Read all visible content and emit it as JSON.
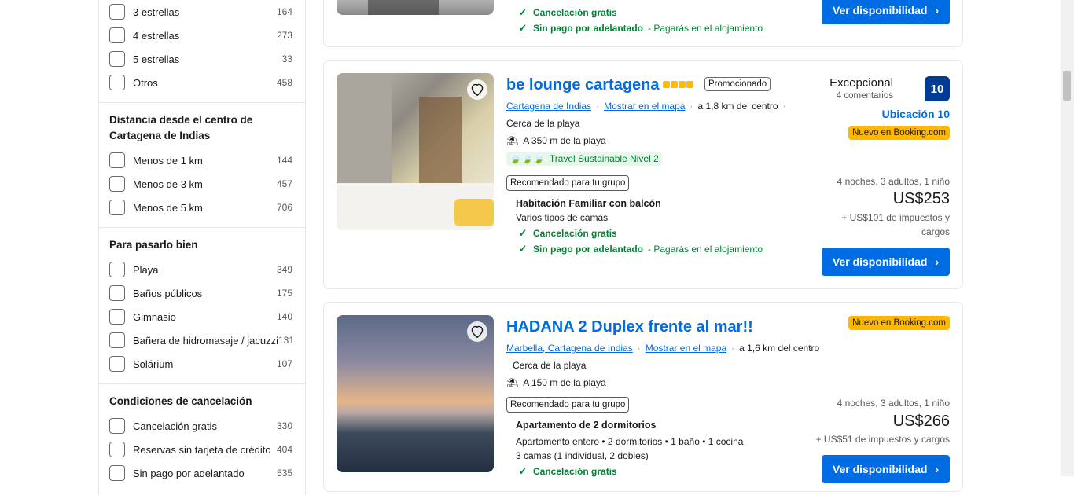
{
  "sidebar": {
    "stars": [
      {
        "label": "3 estrellas",
        "count": "164"
      },
      {
        "label": "4 estrellas",
        "count": "273"
      },
      {
        "label": "5 estrellas",
        "count": "33"
      },
      {
        "label": "Otros",
        "count": "458"
      }
    ],
    "distance": {
      "title": "Distancia desde el centro de Cartagena de Indias",
      "items": [
        {
          "label": "Menos de 1 km",
          "count": "144"
        },
        {
          "label": "Menos de 3 km",
          "count": "457"
        },
        {
          "label": "Menos de 5 km",
          "count": "706"
        }
      ]
    },
    "fun": {
      "title": "Para pasarlo bien",
      "items": [
        {
          "label": "Playa",
          "count": "349"
        },
        {
          "label": "Baños públicos",
          "count": "175"
        },
        {
          "label": "Gimnasio",
          "count": "140"
        },
        {
          "label": "Bañera de hidromasaje / jacuzzi",
          "count": "131"
        },
        {
          "label": "Solárium",
          "count": "107"
        }
      ]
    },
    "cancel": {
      "title": "Condiciones de cancelación",
      "items": [
        {
          "label": "Cancelación gratis",
          "count": "330"
        },
        {
          "label": "Reservas sin tarjeta de crédito",
          "count": "404"
        },
        {
          "label": "Sin pago por adelantado",
          "count": "535"
        }
      ]
    }
  },
  "top_card": {
    "free_cancel": "Cancelación gratis",
    "no_prepay": "Sin pago por adelantado",
    "no_prepay_note": "- Pagarás en el alojamiento",
    "button": "Ver disponibilidad"
  },
  "card1": {
    "title": "be lounge cartagena",
    "promo": "Promocionado",
    "city": "Cartagena de Indias",
    "map": "Mostrar en el mapa",
    "distance": "a 1,8 km del centro",
    "near_beach": "Cerca de la playa",
    "beach_distance": "A 350 m de la playa",
    "sustainable": "Travel Sustainable Nivel 2",
    "recommended": "Recomendado para tu grupo",
    "room": "Habitación Familiar con balcón",
    "beds": "Varios tipos de camas",
    "free_cancel": "Cancelación gratis",
    "no_prepay": "Sin pago por adelantado",
    "no_prepay_note": "- Pagarás en el alojamiento",
    "rating_word": "Excepcional",
    "reviews": "4 comentarios",
    "score": "10",
    "location": "Ubicación 10",
    "new": "Nuevo en Booking.com",
    "nights": "4 noches, 3 adultos, 1 niño",
    "price": "US$253",
    "taxes1": "+ US$101 de impuestos y",
    "taxes2": "cargos",
    "button": "Ver disponibilidad",
    "stars": 4
  },
  "card2": {
    "title": "HADANA 2 Duplex frente al mar!!",
    "city": "Marbella, Cartagena de Indias",
    "map": "Mostrar en el mapa",
    "distance": "a 1,6 km del centro",
    "near_beach": "Cerca de la playa",
    "beach_distance": "A 150 m de la playa",
    "recommended": "Recomendado para tu grupo",
    "room": "Apartamento de 2 dormitorios",
    "details": "Apartamento entero • 2 dormitorios • 1 baño • 1 cocina",
    "beds": "3 camas (1 individual, 2 dobles)",
    "free_cancel": "Cancelación gratis",
    "new": "Nuevo en Booking.com",
    "nights": "4 noches, 3 adultos, 1 niño",
    "price": "US$266",
    "taxes": "+ US$51 de impuestos y cargos",
    "button": "Ver disponibilidad"
  },
  "colors": {
    "brand_blue": "#006ce4",
    "dark_blue": "#003b95",
    "green": "#008234",
    "yellow": "#ffb700",
    "star": "#febb02"
  }
}
